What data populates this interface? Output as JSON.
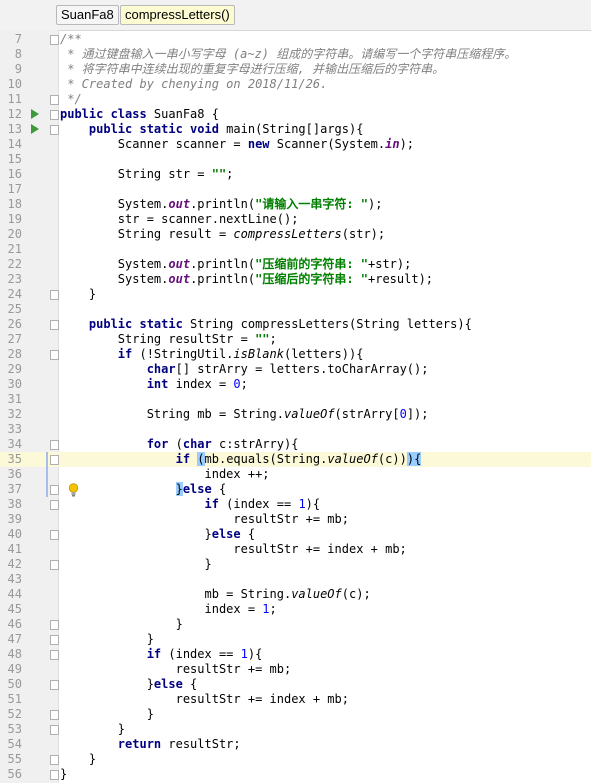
{
  "breadcrumb": [
    "SuanFa8",
    "compressLetters()"
  ],
  "code_lines": [
    {
      "n": "7",
      "html": "<span class='cmt'>/**</span>"
    },
    {
      "n": "8",
      "html": "<span class='cmt'> * 通过键盘输入一串小写字母 (a~z) 组成的字符串。请编写一个字符串压缩程序。</span>"
    },
    {
      "n": "9",
      "html": "<span class='cmt'> * 将字符串中连续出现的重复字母进行压缩, 并输出压缩后的字符串。</span>"
    },
    {
      "n": "10",
      "html": "<span class='cmt'> * Created by chenying on 2018/11/26.</span>"
    },
    {
      "n": "11",
      "html": "<span class='cmt'> */</span>"
    },
    {
      "n": "12",
      "html": "<span class='kw'>public class</span> SuanFa8 {"
    },
    {
      "n": "13",
      "html": "    <span class='kw'>public static void</span> main(String[]args){"
    },
    {
      "n": "14",
      "html": "        Scanner scanner = <span class='kw'>new</span> Scanner(System.<span class='fld'>in</span>);"
    },
    {
      "n": "15",
      "html": ""
    },
    {
      "n": "16",
      "html": "        String str = <span class='str'>\"\"</span>;"
    },
    {
      "n": "17",
      "html": ""
    },
    {
      "n": "18",
      "html": "        System.<span class='fld'>out</span>.println(<span class='str'>\"请输入一串字符: \"</span>);"
    },
    {
      "n": "19",
      "html": "        str = scanner.nextLine();"
    },
    {
      "n": "20",
      "html": "        String result = <span class='ital'>compressLetters</span>(str);"
    },
    {
      "n": "21",
      "html": ""
    },
    {
      "n": "22",
      "html": "        System.<span class='fld'>out</span>.println(<span class='str'>\"压缩前的字符串: \"</span>+str);"
    },
    {
      "n": "23",
      "html": "        System.<span class='fld'>out</span>.println(<span class='str'>\"压缩后的字符串: \"</span>+result);"
    },
    {
      "n": "24",
      "html": "    }"
    },
    {
      "n": "25",
      "html": ""
    },
    {
      "n": "26",
      "html": "    <span class='kw'>public static</span> String compressLetters(String letters){"
    },
    {
      "n": "27",
      "html": "        String resultStr = <span class='str'>\"\"</span>;"
    },
    {
      "n": "28",
      "html": "        <span class='kw'>if</span> (!StringUtil.<span class='ital'>isBlank</span>(letters)){"
    },
    {
      "n": "29",
      "html": "            <span class='kw'>char</span>[] strArry = letters.toCharArray();"
    },
    {
      "n": "30",
      "html": "            <span class='kw'>int</span> index = <span class='num'>0</span>;"
    },
    {
      "n": "31",
      "html": ""
    },
    {
      "n": "32",
      "html": "            String mb = String.<span class='ital'>valueOf</span>(strArry[<span class='num'>0</span>]);"
    },
    {
      "n": "33",
      "html": ""
    },
    {
      "n": "34",
      "html": "            <span class='kw'>for</span> (<span class='kw'>char</span> c:strArry){"
    },
    {
      "n": "35",
      "html": "                <span class='kw'>if</span> <span class='brace'>(</span>mb.equals(String.<span class='ital'>valueOf</span>(c))<span class='brace'>)</span><span class='brace'>{</span>"
    },
    {
      "n": "36",
      "html": "                    index ++;"
    },
    {
      "n": "37",
      "html": "                <span class='brace'>}</span><span class='kw'>else</span> {"
    },
    {
      "n": "38",
      "html": "                    <span class='kw'>if</span> (index == <span class='num'>1</span>){"
    },
    {
      "n": "39",
      "html": "                        resultStr += mb;"
    },
    {
      "n": "40",
      "html": "                    }<span class='kw'>else</span> {"
    },
    {
      "n": "41",
      "html": "                        resultStr += index + mb;"
    },
    {
      "n": "42",
      "html": "                    }"
    },
    {
      "n": "43",
      "html": ""
    },
    {
      "n": "44",
      "html": "                    mb = String.<span class='ital'>valueOf</span>(c);"
    },
    {
      "n": "45",
      "html": "                    index = <span class='num'>1</span>;"
    },
    {
      "n": "46",
      "html": "                }"
    },
    {
      "n": "47",
      "html": "            }"
    },
    {
      "n": "48",
      "html": "            <span class='kw'>if</span> (index == <span class='num'>1</span>){"
    },
    {
      "n": "49",
      "html": "                resultStr += mb;"
    },
    {
      "n": "50",
      "html": "            }<span class='kw'>else</span> {"
    },
    {
      "n": "51",
      "html": "                resultStr += index + mb;"
    },
    {
      "n": "52",
      "html": "            }"
    },
    {
      "n": "53",
      "html": "        }"
    },
    {
      "n": "54",
      "html": "        <span class='kw'>return</span> resultStr;"
    },
    {
      "n": "55",
      "html": "    }"
    },
    {
      "n": "56",
      "html": "}"
    }
  ],
  "highlighted_line": "35",
  "run_lines": [
    "12",
    "13"
  ],
  "fold_lines": [
    "7",
    "11",
    "12",
    "13",
    "24",
    "26",
    "28",
    "34",
    "35",
    "37",
    "38",
    "40",
    "42",
    "46",
    "47",
    "48",
    "50",
    "52",
    "53",
    "55",
    "56"
  ],
  "intention_bulb_line": "37",
  "colors": {
    "keyword": "#000080",
    "string": "#008000",
    "static_field": "#660e7a",
    "number": "#0000ff",
    "comment": "#808080",
    "caret_line": "#fcf9d9"
  }
}
